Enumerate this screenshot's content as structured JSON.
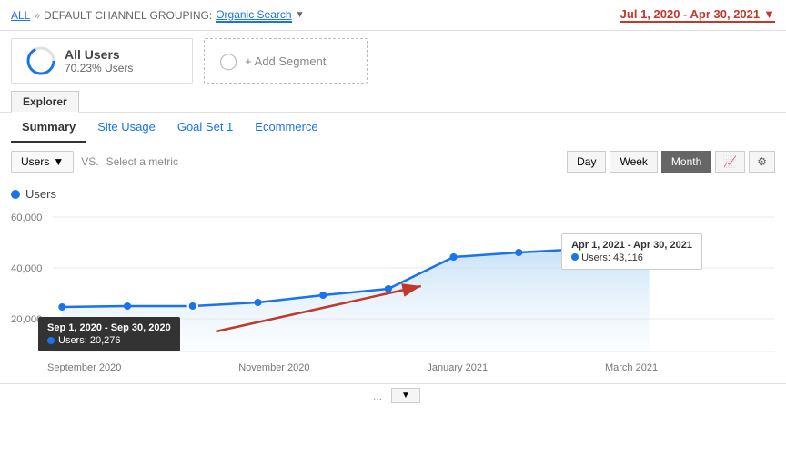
{
  "breadcrumb": {
    "all": "ALL",
    "separator": "»",
    "channel": "DEFAULT CHANNEL GROUPING:",
    "organic": "Organic Search"
  },
  "dateRange": {
    "label": "Jul 1, 2020 - Apr 30, 2021",
    "arrow": "▼"
  },
  "segments": {
    "allUsers": {
      "label": "All Users",
      "sublabel": "70.23% Users"
    },
    "addSegment": "+ Add Segment"
  },
  "explorerTab": "Explorer",
  "subTabs": [
    "Summary",
    "Site Usage",
    "Goal Set 1",
    "Ecommerce"
  ],
  "activeSubTab": "Summary",
  "metric": {
    "primary": "Users",
    "primaryArrow": "▼",
    "vs": "VS.",
    "secondary": "Select a metric"
  },
  "timeBtns": [
    "Day",
    "Week",
    "Month"
  ],
  "activeTimeBtn": "Month",
  "chartLegend": "Users",
  "yAxis": [
    "60,000",
    "40,000",
    "20,000"
  ],
  "xAxis": [
    "September 2020",
    "November 2020",
    "January 2021",
    "March 2021"
  ],
  "tooltip1": {
    "date": "Sep 1, 2020 - Sep 30, 2020",
    "metric": "Users: 20,276"
  },
  "tooltip2": {
    "date": "Apr 1, 2021 - Apr 30, 2021",
    "metric": "Users: 43,116"
  }
}
